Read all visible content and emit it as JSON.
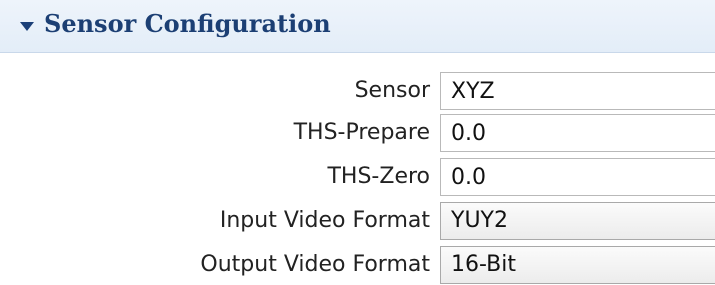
{
  "section": {
    "title": "Sensor Configuration",
    "toggle_icon": "triangle-down-icon"
  },
  "fields": {
    "sensor": {
      "label": "Sensor",
      "value": "XYZ"
    },
    "ths_prepare": {
      "label": "THS-Prepare",
      "value": "0.0"
    },
    "ths_zero": {
      "label": "THS-Zero",
      "value": "0.0"
    },
    "input_video_format": {
      "label": "Input Video Format",
      "value": "YUY2"
    },
    "output_video_format": {
      "label": "Output Video Format",
      "value": "16-Bit"
    }
  }
}
